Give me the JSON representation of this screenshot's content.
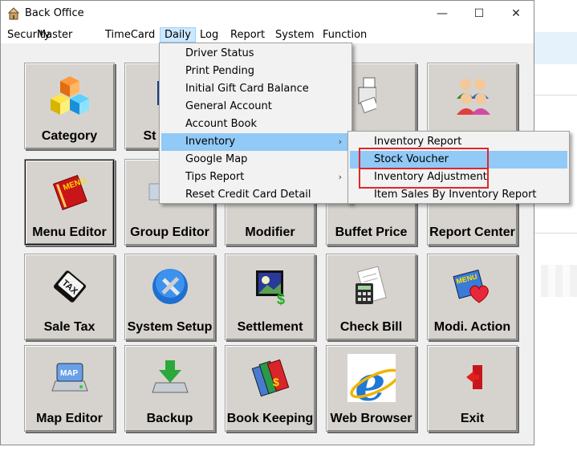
{
  "window": {
    "title": "Back Office",
    "controls": {
      "minimize": "—",
      "maximize": "☐",
      "close": "✕"
    }
  },
  "menubar": [
    {
      "label": "Security"
    },
    {
      "label": "Master"
    },
    {
      "label": "TimeCard"
    },
    {
      "label": "Daily",
      "active": true
    },
    {
      "label": "Log"
    },
    {
      "label": "Report"
    },
    {
      "label": "System"
    },
    {
      "label": "Function"
    }
  ],
  "daily_menu": [
    {
      "label": "Driver Status"
    },
    {
      "label": "Print Pending"
    },
    {
      "label": "Initial Gift Card Balance"
    },
    {
      "label": "General Account"
    },
    {
      "label": "Account Book"
    },
    {
      "label": "Inventory",
      "submenu": true,
      "highlighted": true
    },
    {
      "label": "Google Map"
    },
    {
      "label": "Tips Report",
      "submenu": true
    },
    {
      "label": "Reset Credit Card Detail"
    }
  ],
  "submenu_arrow": "›",
  "inventory_submenu": [
    {
      "label": "Inventory Report"
    },
    {
      "label": "Stock Voucher",
      "highlighted": true,
      "boxed": true
    },
    {
      "label": "Inventory Adjustment",
      "boxed": true
    },
    {
      "label": "Item Sales By Inventory Report"
    }
  ],
  "tiles": [
    {
      "label": "Category",
      "icon": "cubes-icon"
    },
    {
      "label": "St",
      "icon": "monitor-icon"
    },
    {
      "label": "",
      "icon": "hidden-tile"
    },
    {
      "label": "",
      "icon": "printer-icon"
    },
    {
      "label": "",
      "icon": "users-icon"
    },
    {
      "label": "Menu Editor",
      "icon": "menu-book-icon",
      "selected": true
    },
    {
      "label": "Group Editor",
      "icon": "group-icon"
    },
    {
      "label": "Modifier",
      "icon": "modifier-icon"
    },
    {
      "label": "Buffet Price",
      "icon": "buffet-icon"
    },
    {
      "label": "Report Center",
      "icon": "report-icon"
    },
    {
      "label": "Sale Tax",
      "icon": "tax-key-icon"
    },
    {
      "label": "System Setup",
      "icon": "tools-icon"
    },
    {
      "label": "Settlement",
      "icon": "money-icon"
    },
    {
      "label": "Check Bill",
      "icon": "calculator-icon"
    },
    {
      "label": "Modi. Action",
      "icon": "heart-menu-icon"
    },
    {
      "label": "Map Editor",
      "icon": "map-drive-icon"
    },
    {
      "label": "Backup",
      "icon": "backup-icon"
    },
    {
      "label": "Book Keeping",
      "icon": "books-icon"
    },
    {
      "label": "Web Browser",
      "icon": "ie-icon"
    },
    {
      "label": "Exit",
      "icon": "exit-door-icon"
    }
  ],
  "colors": {
    "menu_highlight": "#91c9f7",
    "menu_active": "#cce8ff",
    "annotation_red": "#e0262b",
    "tile_face": "#d6d3ce"
  }
}
